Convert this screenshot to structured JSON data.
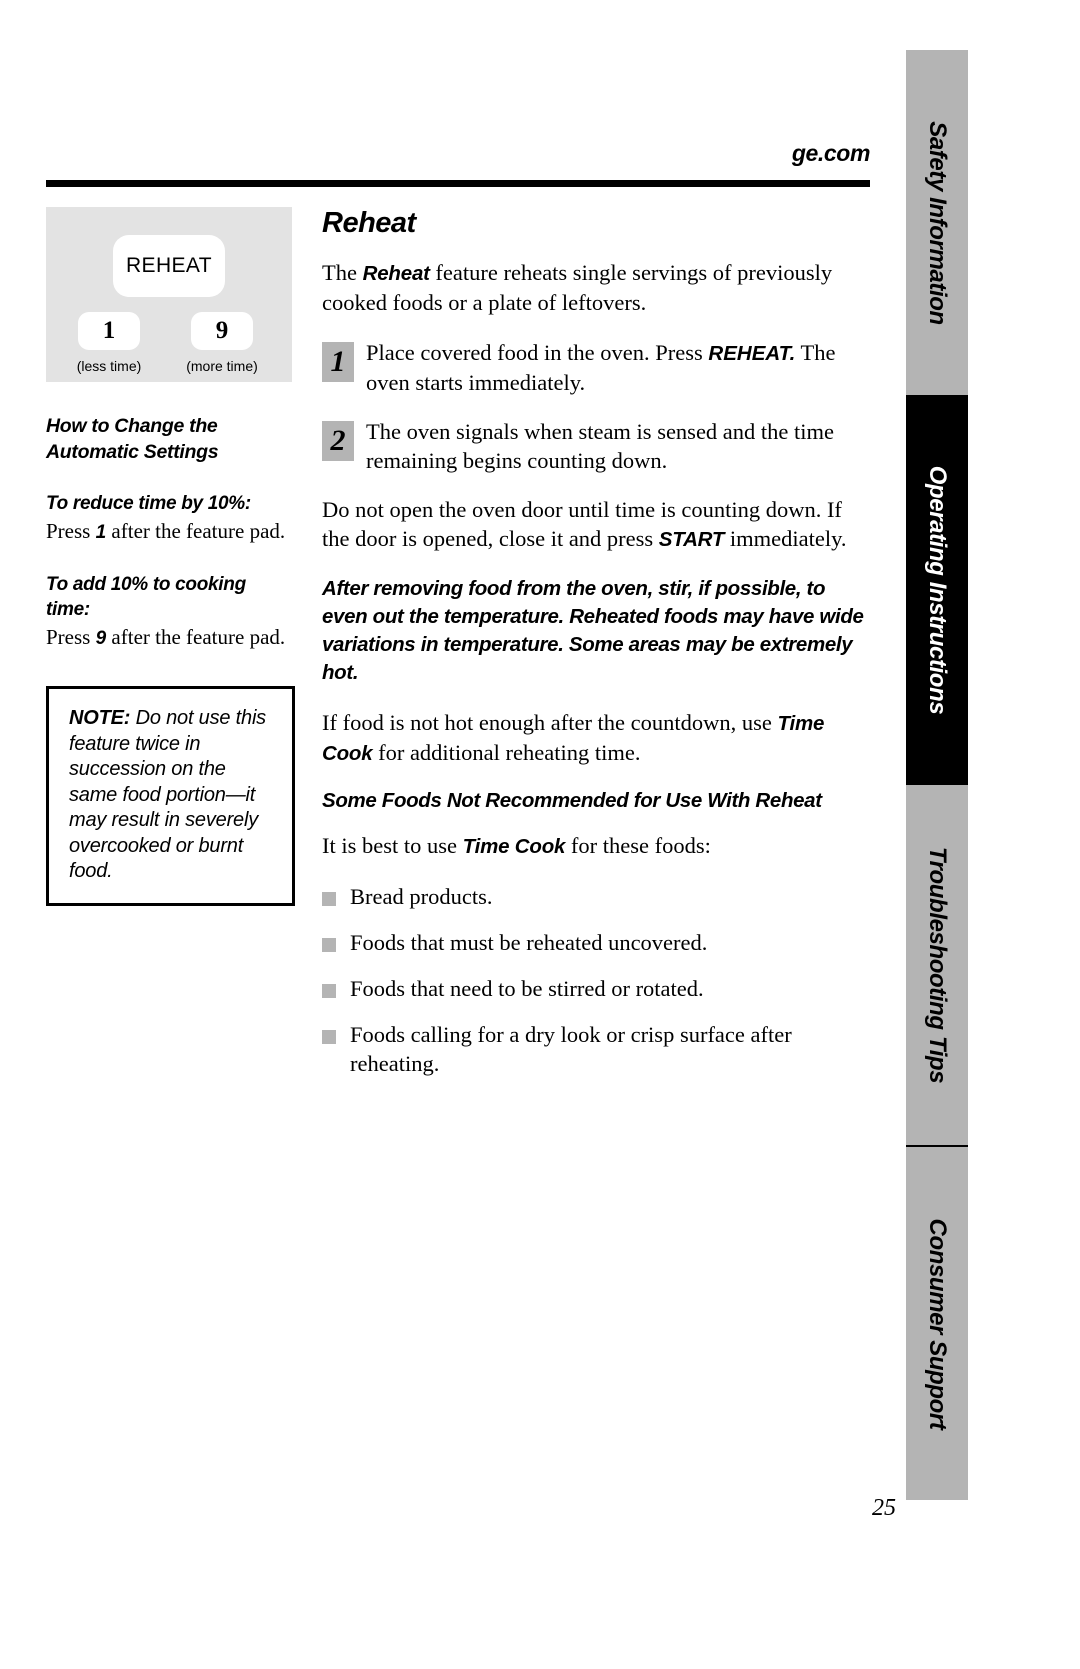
{
  "header": {
    "site": "ge.com"
  },
  "keypad": {
    "main_key_label": "REHEAT",
    "key_less": "1",
    "key_more": "9",
    "caption_less": "(less time)",
    "caption_more": "(more time)"
  },
  "left": {
    "section_heading": "How to Change the\nAutomatic Settings",
    "reduce_label": "To reduce time by 10%:",
    "reduce_body_pre": "Press ",
    "reduce_body_key": "1",
    "reduce_body_post": " after the feature pad.",
    "add_label": "To add 10% to cooking time:",
    "add_body_pre": "Press ",
    "add_body_key": "9",
    "add_body_post": " after the feature pad.",
    "note_title": "NOTE:",
    "note_body": " Do not use this feature twice in succession on the same food portion—it may result in severely overcooked or burnt food."
  },
  "main": {
    "title": "Reheat",
    "intro_pre": "The ",
    "intro_bold": "Reheat",
    "intro_post": "  feature reheats single servings of previously cooked foods or a plate of leftovers.",
    "steps": [
      {
        "number": "1",
        "text_pre": "Place covered food in the oven. Press ",
        "text_bold": "REHEAT.",
        "text_post": " The oven starts immediately."
      },
      {
        "number": "2",
        "text_pre": "The oven signals when steam is sensed and the time remaining begins counting down.",
        "text_bold": "",
        "text_post": ""
      }
    ],
    "door_pre": "Do not open the oven door until time is counting down. If the door is opened, close it and press ",
    "door_bold": "START",
    "door_post": " immediately.",
    "warning": "After removing food from the oven, stir, if possible, to even out the temperature. Reheated foods may have wide variations in temperature. Some areas may be extremely hot.",
    "not_hot_pre": "If food is not hot enough after the countdown, use ",
    "not_hot_bold": "Time Cook",
    "not_hot_post": " for additional reheating time.",
    "sub_heading": "Some Foods Not Recommended for Use With Reheat",
    "best_pre": "It is best to use ",
    "best_bold": "Time Cook",
    "best_post": " for these foods:",
    "bullets": [
      "Bread products.",
      "Foods that must be reheated uncovered.",
      "Foods that need to be stirred or rotated.",
      "Foods calling for a dry look or crisp surface after reheating."
    ]
  },
  "rail": {
    "tabs": [
      {
        "label": "Safety Information",
        "active": false
      },
      {
        "label": "Operating Instructions",
        "active": true
      },
      {
        "label": "Troubleshooting Tips",
        "active": false
      },
      {
        "label": "Consumer Support",
        "active": false
      }
    ]
  },
  "footer": {
    "page_number": "25"
  },
  "colors": {
    "tab_inactive": "#b4b4b4",
    "tab_active": "#000000",
    "keypad_bg": "#e3e3e3",
    "bullet": "#b4b4b4",
    "step_box": "#b4b4b4"
  }
}
